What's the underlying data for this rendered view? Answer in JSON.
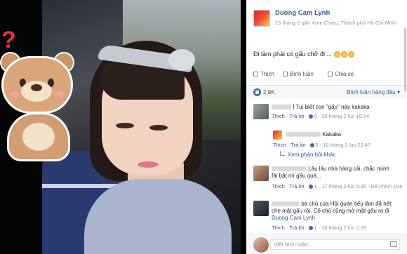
{
  "post": {
    "author": "Duong Cam Lynh",
    "meta": "15 tháng 2 gần Xom Chieu, Thành phố Hồ Chí Minh",
    "caption": "Đi làm phải có gấu chở đi ...",
    "emojis": [
      "grin-emoji",
      "grin-emoji",
      "grin-emoji"
    ]
  },
  "actions": {
    "like": "Thích",
    "comment": "Bình luận",
    "share": "Chia sẻ"
  },
  "stats": {
    "likes": "2,9K",
    "sort": "Bình luận hàng đầu ▾"
  },
  "comments": [
    {
      "text": "Í Tui biết con \"gấu\" này kakaka",
      "like": "Thích",
      "reply": "Trả lời",
      "likes": "8",
      "time": "15 tháng 2 lúc 16:14"
    },
    {
      "text": "Kakaka",
      "like": "Thích",
      "reply": "Trả lời",
      "likes": "3",
      "time": "16 tháng 2 lúc 22:47"
    },
    {
      "text_line1": "Lâu lâu nhà hàng cải, chắc mình",
      "text_line2": "fải bật mí gấu quá...",
      "like": "Thích",
      "reply": "Trả lời",
      "likes": "1",
      "time": "17 tháng 2 lúc 5:36",
      "edited": "Đã chỉnh sửa"
    },
    {
      "text_line1": "bà chủ của Hội quán tiểu lâm đã hết",
      "text_line2": "che mặt gấu rồi. Cô chủ cũng mở mặt gấu ra đi",
      "mention": "Duong Cam Lynh",
      "like": "Thích",
      "reply": "Trả lời",
      "likes": "1",
      "time": "16 tháng 2 lúc 2:28"
    }
  ],
  "more_replies": "Xem phản hồi khác",
  "composer": {
    "placeholder": "Viết bình luận..."
  }
}
